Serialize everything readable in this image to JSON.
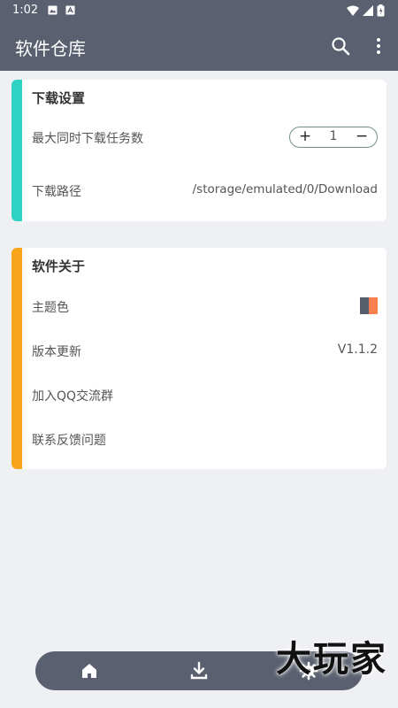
{
  "status_bar": {
    "time": "1:02"
  },
  "app_bar": {
    "title": "软件仓库"
  },
  "download_settings": {
    "title": "下载设置",
    "accent": "#2ed1c2",
    "max_tasks_label": "最大同时下载任务数",
    "max_tasks_value": "1",
    "plus": "+",
    "minus": "−",
    "path_label": "下载路径",
    "path_value": "/storage/emulated/0/Download"
  },
  "about": {
    "title": "软件关于",
    "accent": "#f8a51c",
    "theme_label": "主题色",
    "theme_colors": [
      "#565d6b",
      "#f7804e"
    ],
    "update_label": "版本更新",
    "version": "V1.1.2",
    "qq_label": "加入QQ交流群",
    "feedback_label": "联系反馈问题"
  },
  "bottom_nav": {
    "items": [
      "home-icon",
      "download-icon",
      "settings-icon"
    ]
  },
  "watermark": "大玩家"
}
